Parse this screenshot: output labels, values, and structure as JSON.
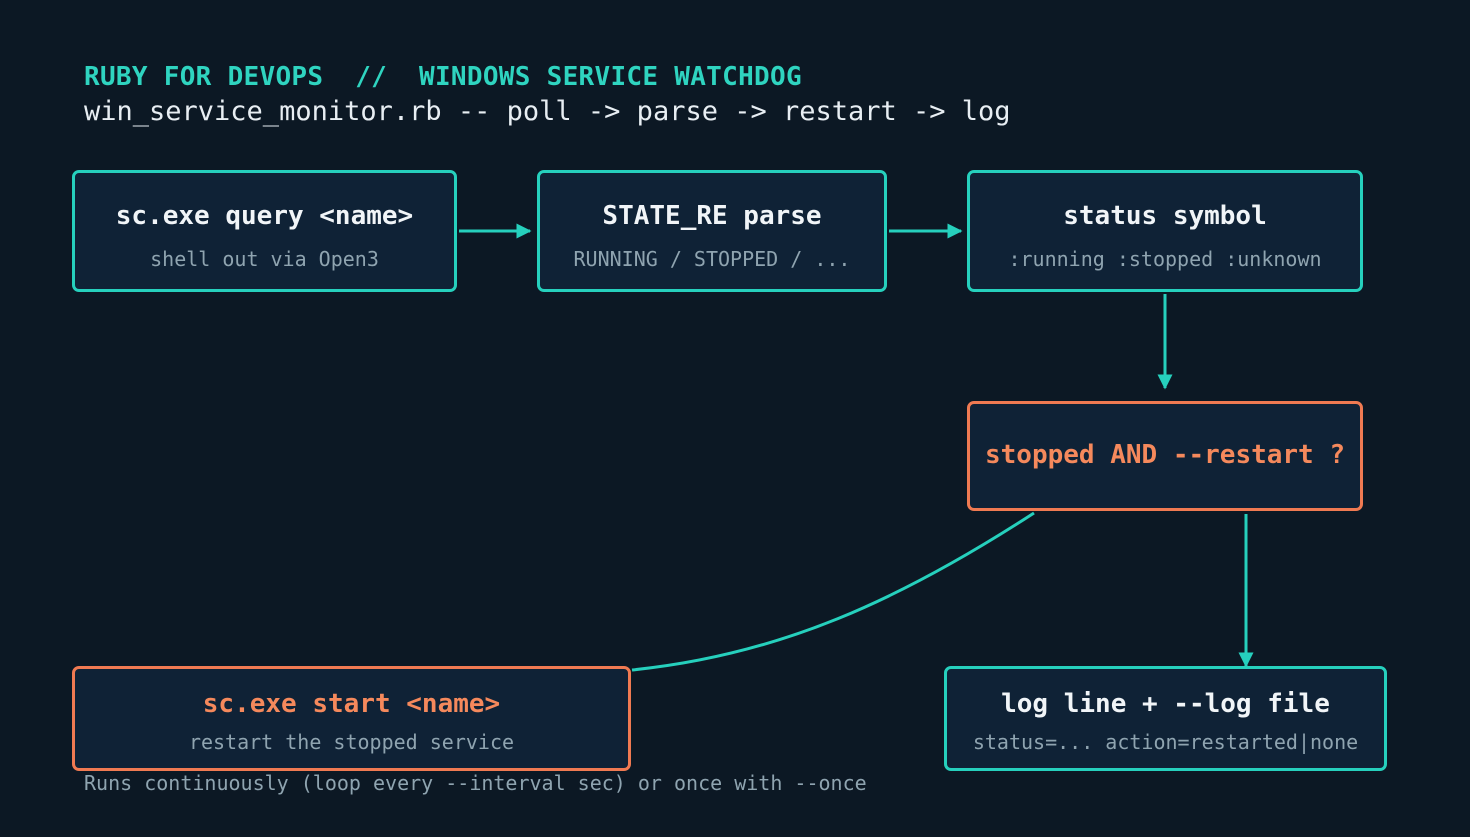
{
  "header": {
    "title": "RUBY FOR DEVOPS  //  WINDOWS SERVICE WATCHDOG",
    "subtitle": "win_service_monitor.rb -- poll -> parse -> restart -> log"
  },
  "nodes": {
    "query": {
      "label": "sc.exe query <name>",
      "sub": "shell out via Open3"
    },
    "parse": {
      "label": "STATE_RE parse",
      "sub": "RUNNING / STOPPED / ..."
    },
    "status": {
      "label": "status symbol",
      "sub": ":running :stopped :unknown"
    },
    "decision": {
      "label": "stopped AND --restart ?"
    },
    "start": {
      "label": "sc.exe start <name>",
      "sub": "restart the stopped service"
    },
    "log": {
      "label": "log line + --log file",
      "sub": "status=... action=restarted|none"
    }
  },
  "footer": {
    "note": "Runs continuously (loop every --interval sec) or once with --once"
  },
  "colors": {
    "background": "#0c1824",
    "teal": "#26d0bd",
    "orange": "#f07a52",
    "box_fill": "#0f2236"
  }
}
